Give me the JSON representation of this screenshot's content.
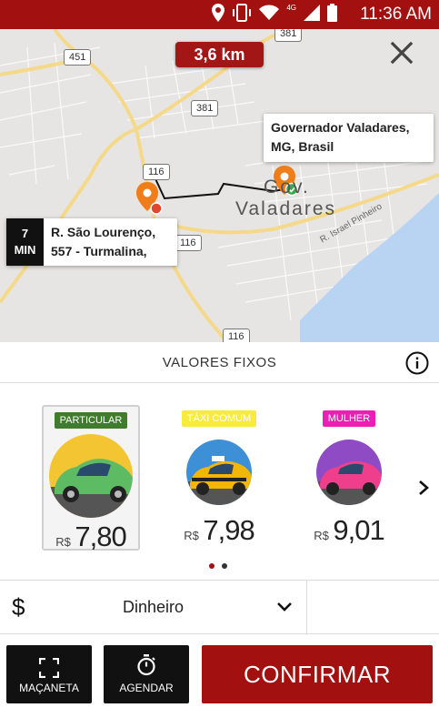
{
  "status_bar": {
    "time": "11:36 AM",
    "network": "4G",
    "icons": [
      "location-icon",
      "vibrate-icon",
      "wifi-icon",
      "signal-icon",
      "battery-icon"
    ]
  },
  "map": {
    "distance": "3,6 km",
    "destination": {
      "line1": "Governador Valadares,",
      "line2": "MG, Brasil"
    },
    "origin": {
      "eta_value": "7",
      "eta_unit": "MIN",
      "line1": "R. São Lourenço,",
      "line2": "557 - Turmalina,"
    },
    "city_label_1": "Gov.",
    "city_label_2": "Valadares",
    "street_label": "R. Israel Pinheiro",
    "road_shields": [
      "451",
      "381",
      "381",
      "116",
      "116",
      "116"
    ]
  },
  "section": {
    "title": "VALORES FIXOS"
  },
  "options": [
    {
      "tag": "PARTICULAR",
      "currency": "R$",
      "price": "7,80",
      "tag_bg": "#3f7d2c",
      "tag_fg": "#ffffff",
      "car_color": "#5dbb63",
      "bg_color": "#f3c532"
    },
    {
      "tag": "TÁXI COMUM",
      "currency": "R$",
      "price": "7,98",
      "tag_bg": "#f7ec3d",
      "tag_fg": "#ffffff",
      "car_color": "#f2b705",
      "bg_color": "#3d8fd6"
    },
    {
      "tag": "MULHER",
      "currency": "R$",
      "price": "9,01",
      "tag_bg": "#ec1fb4",
      "tag_fg": "#ffffff",
      "car_color": "#ef3f8c",
      "bg_color": "#8e4bc4"
    }
  ],
  "pager": {
    "active_color": "#a31010",
    "inactive_color": "#333333"
  },
  "payment": {
    "icon": "$",
    "method": "Dinheiro"
  },
  "buttons": {
    "handle": "MAÇANETA",
    "schedule": "AGENDAR",
    "confirm": "CONFIRMAR"
  },
  "colors": {
    "brand": "#a31010",
    "dark": "#111111"
  }
}
